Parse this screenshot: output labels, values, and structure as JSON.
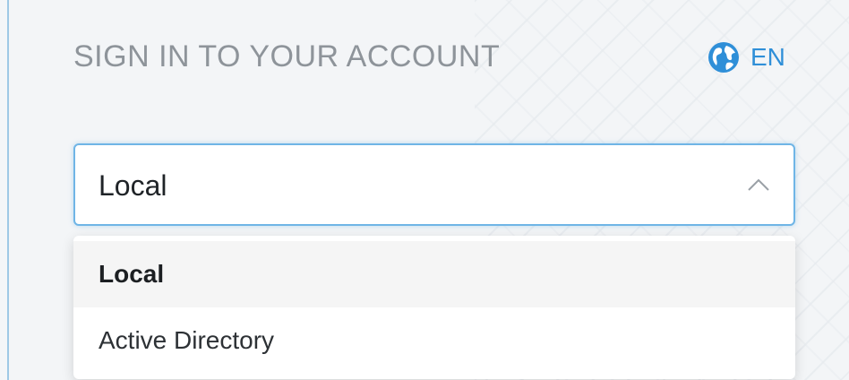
{
  "header": {
    "title": "SIGN IN TO YOUR ACCOUNT",
    "language": {
      "code": "EN",
      "icon": "globe-icon",
      "icon_color": "#2f8fd8"
    }
  },
  "login_type_select": {
    "value": "Local",
    "icon": "chevron-up-icon",
    "border_color": "#6fb5e6",
    "expanded": true
  },
  "login_type_options": [
    {
      "label": "Local",
      "selected": true
    },
    {
      "label": "Active Directory",
      "selected": false
    }
  ]
}
